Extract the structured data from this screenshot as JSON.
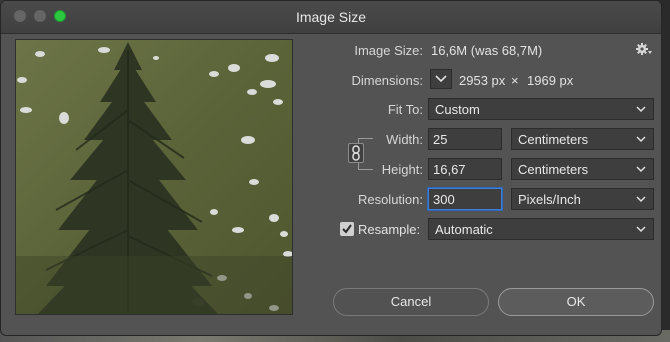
{
  "window": {
    "title": "Image Size"
  },
  "image_size": {
    "label": "Image Size:",
    "value": "16,6M (was 68,7M)"
  },
  "dimensions": {
    "label": "Dimensions:",
    "width": "2953 px",
    "times": "×",
    "height": "1969 px"
  },
  "fit_to": {
    "label": "Fit To:",
    "value": "Custom"
  },
  "width": {
    "label": "Width:",
    "value": "25",
    "unit": "Centimeters"
  },
  "height": {
    "label": "Height:",
    "value": "16,67",
    "unit": "Centimeters"
  },
  "resolution": {
    "label": "Resolution:",
    "value": "300",
    "unit": "Pixels/Inch"
  },
  "resample": {
    "label": "Resample:",
    "checked": true,
    "value": "Automatic"
  },
  "buttons": {
    "cancel": "Cancel",
    "ok": "OK"
  },
  "colors": {
    "focus": "#3d7fd8",
    "zoom_button": "#2bc840",
    "dialog_bg": "#535353"
  },
  "icons": [
    "gear-icon",
    "chain-link-icon",
    "chevron-down-icon",
    "checkmark-icon"
  ]
}
